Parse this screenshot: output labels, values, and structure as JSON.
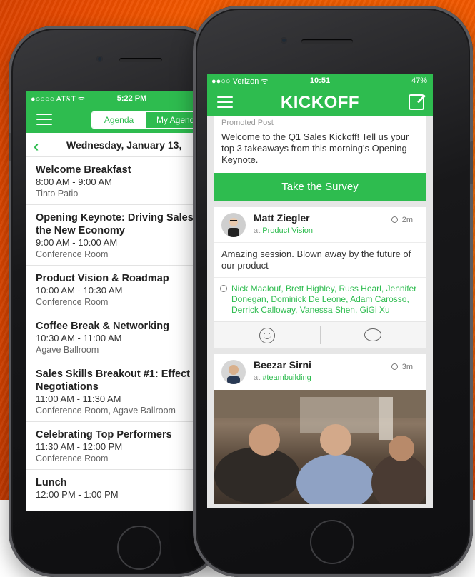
{
  "agenda_app": {
    "status": {
      "carrier": "●○○○○ AT&T ᯤ",
      "time": "5:22 PM"
    },
    "tabs": [
      "Agenda",
      "My Agenda"
    ],
    "date": "Wednesday, January 13,",
    "items": [
      {
        "title": "Welcome Breakfast",
        "time": "8:00 AM - 9:00 AM",
        "location": "Tinto Patio"
      },
      {
        "title": "Opening Keynote: Driving Sales",
        "title2": "the New Economy",
        "time": "9:00 AM - 10:00 AM",
        "location": "Conference Room"
      },
      {
        "title": "Product Vision & Roadmap",
        "time": "10:00 AM - 10:30 AM",
        "location": "Conference Room"
      },
      {
        "title": "Coffee Break & Networking",
        "time": "10:30 AM - 11:00 AM",
        "location": "Agave Ballroom"
      },
      {
        "title": "Sales Skills Breakout #1: Effect",
        "title2": "Negotiations",
        "time": "11:00 AM - 11:30 AM",
        "location": "Conference Room, Agave Ballroom"
      },
      {
        "title": "Celebrating Top Performers",
        "time": "11:30 AM - 12:00 PM",
        "location": "Conference Room"
      },
      {
        "title": "Lunch",
        "time": "12:00 PM - 1:00 PM",
        "location": ""
      }
    ]
  },
  "feed_app": {
    "status": {
      "carrier": "●●○○ Verizon ᯤ",
      "time": "10:51",
      "battery": "47%"
    },
    "logo": "KICKOFF",
    "promo": {
      "label": "Promoted Post",
      "text": "Welcome to the Q1 Sales Kickoff! Tell us your top 3 takeaways from this morning's Opening Keynote.",
      "button": "Take the Survey"
    },
    "posts": [
      {
        "name": "Matt Ziegler",
        "at": "at",
        "context": "Product Vision",
        "ago": "2m",
        "body": "Amazing session. Blown away by the future of our product",
        "likes": "Nick Maalouf, Brett Highley, Russ Hearl, Jennifer Donegan, Dominick De Leone, Adam Carosso, Derrick Calloway, Vanessa Shen, GiGi Xu"
      },
      {
        "name": "Beezar Sirni",
        "at": "at",
        "context": "#teambuilding",
        "ago": "3m"
      }
    ]
  },
  "colors": {
    "accent": "#2ebc4f",
    "background": "#ff6a00"
  }
}
